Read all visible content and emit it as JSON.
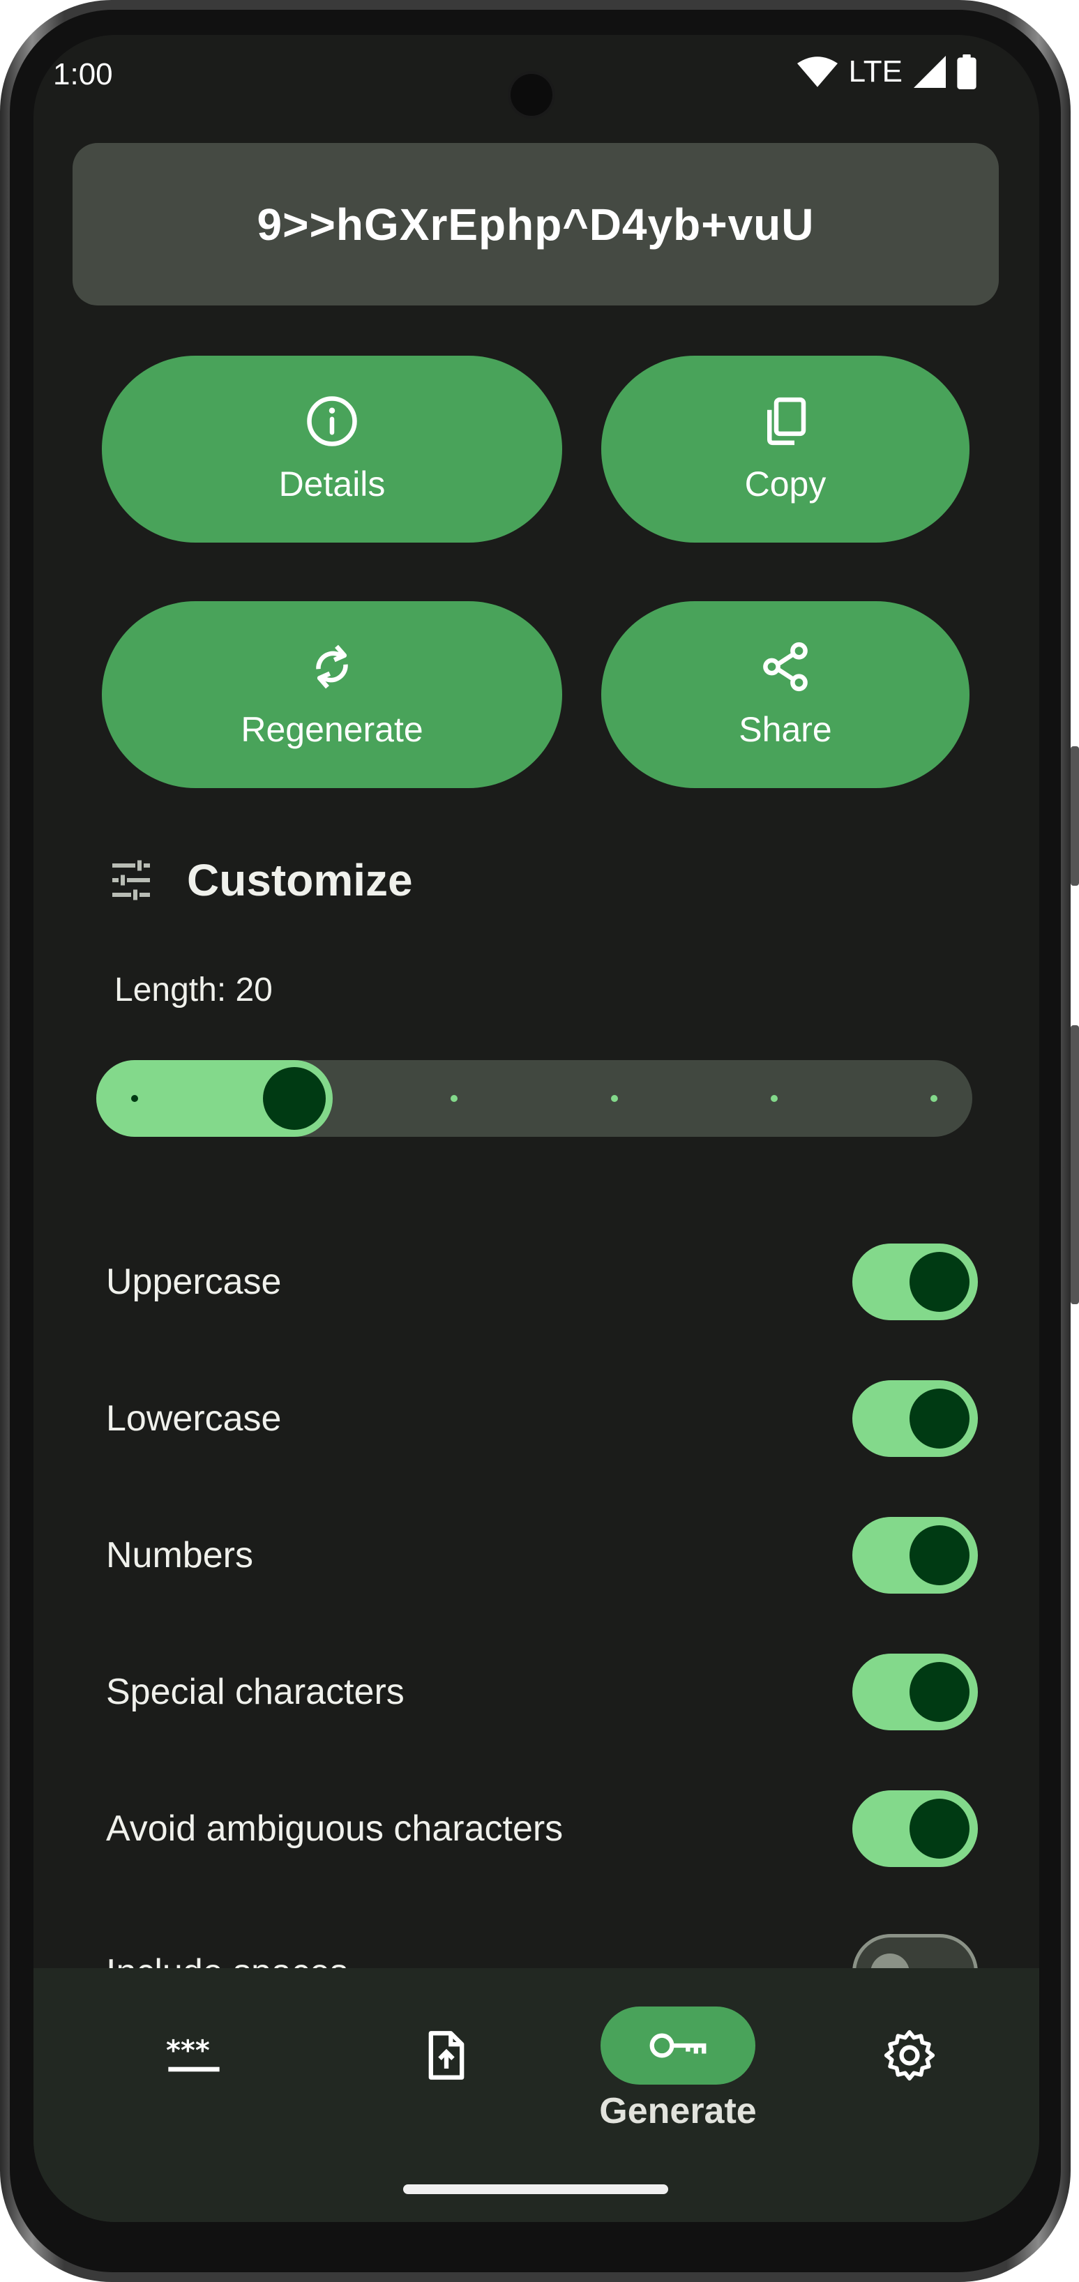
{
  "status_bar": {
    "time": "1:00",
    "network": "LTE"
  },
  "password": {
    "value": "9>>hGXrEphp^D4yb+vuU"
  },
  "actions": {
    "details": "Details",
    "copy": "Copy",
    "regenerate": "Regenerate",
    "share": "Share"
  },
  "customize": {
    "title": "Customize",
    "length_label": "Length: 20",
    "length_slider": {
      "value": 20,
      "steps": 6,
      "selected_step_index": 1
    }
  },
  "options": [
    {
      "label": "Uppercase",
      "enabled": true
    },
    {
      "label": "Lowercase",
      "enabled": true
    },
    {
      "label": "Numbers",
      "enabled": true
    },
    {
      "label": "Special characters",
      "enabled": true
    },
    {
      "label": "Avoid ambiguous characters",
      "enabled": true
    },
    {
      "label": "Include spaces",
      "enabled": false
    }
  ],
  "nav": {
    "items": [
      {
        "icon": "password-icon",
        "label": ""
      },
      {
        "icon": "file-upload-icon",
        "label": ""
      },
      {
        "icon": "key-icon",
        "label": "Generate",
        "active": true
      },
      {
        "icon": "gear-icon",
        "label": ""
      }
    ]
  },
  "colors": {
    "accent": "#49a35a",
    "accent_light": "#83d98b",
    "background": "#1b1c1a",
    "password_bg": "#454a43"
  }
}
